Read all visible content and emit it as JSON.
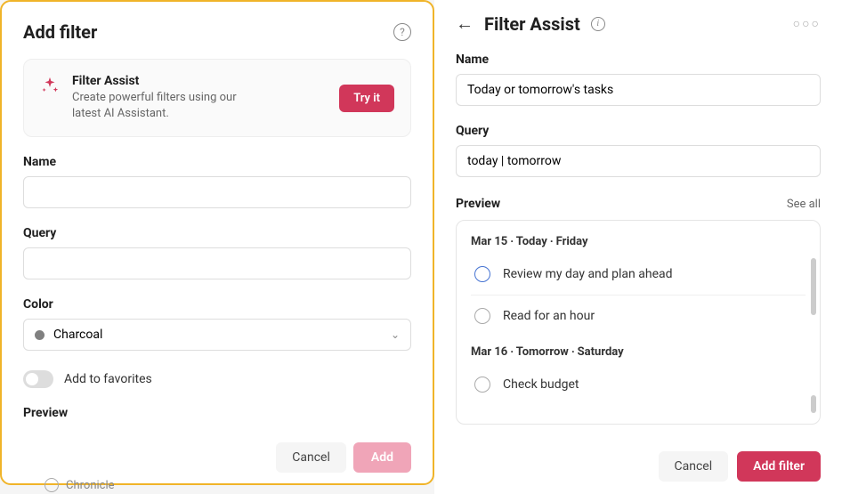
{
  "left": {
    "title": "Add filter",
    "help": "?",
    "assist": {
      "title": "Filter Assist",
      "desc": "Create powerful filters using our latest AI Assistant.",
      "try": "Try it"
    },
    "nameLabel": "Name",
    "nameValue": "",
    "queryLabel": "Query",
    "queryValue": "",
    "colorLabel": "Color",
    "colorValue": "Charcoal",
    "favLabel": "Add to favorites",
    "previewLabel": "Preview",
    "cancel": "Cancel",
    "add": "Add"
  },
  "right": {
    "title": "Filter Assist",
    "nameLabel": "Name",
    "nameValue": "Today or tomorrow's tasks",
    "queryLabel": "Query",
    "queryValue": "today | tomorrow",
    "previewLabel": "Preview",
    "seeAll": "See all",
    "sections": [
      {
        "date": "Mar 15 ‧ Today ‧ Friday",
        "tasks": [
          {
            "text": "Review my day and plan ahead",
            "today": true
          },
          {
            "text": "Read for an hour",
            "today": false
          }
        ]
      },
      {
        "date": "Mar 16 ‧ Tomorrow ‧ Saturday",
        "tasks": [
          {
            "text": "Check budget",
            "today": false
          }
        ]
      }
    ],
    "cancel": "Cancel",
    "add": "Add filter"
  },
  "bg": {
    "chronicle": "Chronicle"
  }
}
